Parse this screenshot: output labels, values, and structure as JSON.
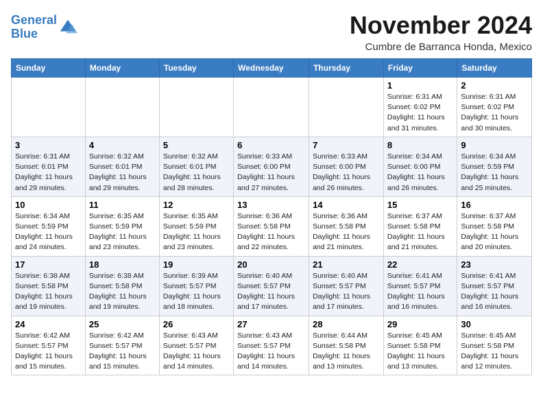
{
  "header": {
    "logo_line1": "General",
    "logo_line2": "Blue",
    "month_title": "November 2024",
    "subtitle": "Cumbre de Barranca Honda, Mexico"
  },
  "weekdays": [
    "Sunday",
    "Monday",
    "Tuesday",
    "Wednesday",
    "Thursday",
    "Friday",
    "Saturday"
  ],
  "weeks": [
    [
      {
        "day": "",
        "info": ""
      },
      {
        "day": "",
        "info": ""
      },
      {
        "day": "",
        "info": ""
      },
      {
        "day": "",
        "info": ""
      },
      {
        "day": "",
        "info": ""
      },
      {
        "day": "1",
        "info": "Sunrise: 6:31 AM\nSunset: 6:02 PM\nDaylight: 11 hours and 31 minutes."
      },
      {
        "day": "2",
        "info": "Sunrise: 6:31 AM\nSunset: 6:02 PM\nDaylight: 11 hours and 30 minutes."
      }
    ],
    [
      {
        "day": "3",
        "info": "Sunrise: 6:31 AM\nSunset: 6:01 PM\nDaylight: 11 hours and 29 minutes."
      },
      {
        "day": "4",
        "info": "Sunrise: 6:32 AM\nSunset: 6:01 PM\nDaylight: 11 hours and 29 minutes."
      },
      {
        "day": "5",
        "info": "Sunrise: 6:32 AM\nSunset: 6:01 PM\nDaylight: 11 hours and 28 minutes."
      },
      {
        "day": "6",
        "info": "Sunrise: 6:33 AM\nSunset: 6:00 PM\nDaylight: 11 hours and 27 minutes."
      },
      {
        "day": "7",
        "info": "Sunrise: 6:33 AM\nSunset: 6:00 PM\nDaylight: 11 hours and 26 minutes."
      },
      {
        "day": "8",
        "info": "Sunrise: 6:34 AM\nSunset: 6:00 PM\nDaylight: 11 hours and 26 minutes."
      },
      {
        "day": "9",
        "info": "Sunrise: 6:34 AM\nSunset: 5:59 PM\nDaylight: 11 hours and 25 minutes."
      }
    ],
    [
      {
        "day": "10",
        "info": "Sunrise: 6:34 AM\nSunset: 5:59 PM\nDaylight: 11 hours and 24 minutes."
      },
      {
        "day": "11",
        "info": "Sunrise: 6:35 AM\nSunset: 5:59 PM\nDaylight: 11 hours and 23 minutes."
      },
      {
        "day": "12",
        "info": "Sunrise: 6:35 AM\nSunset: 5:59 PM\nDaylight: 11 hours and 23 minutes."
      },
      {
        "day": "13",
        "info": "Sunrise: 6:36 AM\nSunset: 5:58 PM\nDaylight: 11 hours and 22 minutes."
      },
      {
        "day": "14",
        "info": "Sunrise: 6:36 AM\nSunset: 5:58 PM\nDaylight: 11 hours and 21 minutes."
      },
      {
        "day": "15",
        "info": "Sunrise: 6:37 AM\nSunset: 5:58 PM\nDaylight: 11 hours and 21 minutes."
      },
      {
        "day": "16",
        "info": "Sunrise: 6:37 AM\nSunset: 5:58 PM\nDaylight: 11 hours and 20 minutes."
      }
    ],
    [
      {
        "day": "17",
        "info": "Sunrise: 6:38 AM\nSunset: 5:58 PM\nDaylight: 11 hours and 19 minutes."
      },
      {
        "day": "18",
        "info": "Sunrise: 6:38 AM\nSunset: 5:58 PM\nDaylight: 11 hours and 19 minutes."
      },
      {
        "day": "19",
        "info": "Sunrise: 6:39 AM\nSunset: 5:57 PM\nDaylight: 11 hours and 18 minutes."
      },
      {
        "day": "20",
        "info": "Sunrise: 6:40 AM\nSunset: 5:57 PM\nDaylight: 11 hours and 17 minutes."
      },
      {
        "day": "21",
        "info": "Sunrise: 6:40 AM\nSunset: 5:57 PM\nDaylight: 11 hours and 17 minutes."
      },
      {
        "day": "22",
        "info": "Sunrise: 6:41 AM\nSunset: 5:57 PM\nDaylight: 11 hours and 16 minutes."
      },
      {
        "day": "23",
        "info": "Sunrise: 6:41 AM\nSunset: 5:57 PM\nDaylight: 11 hours and 16 minutes."
      }
    ],
    [
      {
        "day": "24",
        "info": "Sunrise: 6:42 AM\nSunset: 5:57 PM\nDaylight: 11 hours and 15 minutes."
      },
      {
        "day": "25",
        "info": "Sunrise: 6:42 AM\nSunset: 5:57 PM\nDaylight: 11 hours and 15 minutes."
      },
      {
        "day": "26",
        "info": "Sunrise: 6:43 AM\nSunset: 5:57 PM\nDaylight: 11 hours and 14 minutes."
      },
      {
        "day": "27",
        "info": "Sunrise: 6:43 AM\nSunset: 5:57 PM\nDaylight: 11 hours and 14 minutes."
      },
      {
        "day": "28",
        "info": "Sunrise: 6:44 AM\nSunset: 5:58 PM\nDaylight: 11 hours and 13 minutes."
      },
      {
        "day": "29",
        "info": "Sunrise: 6:45 AM\nSunset: 5:58 PM\nDaylight: 11 hours and 13 minutes."
      },
      {
        "day": "30",
        "info": "Sunrise: 6:45 AM\nSunset: 5:58 PM\nDaylight: 11 hours and 12 minutes."
      }
    ]
  ]
}
